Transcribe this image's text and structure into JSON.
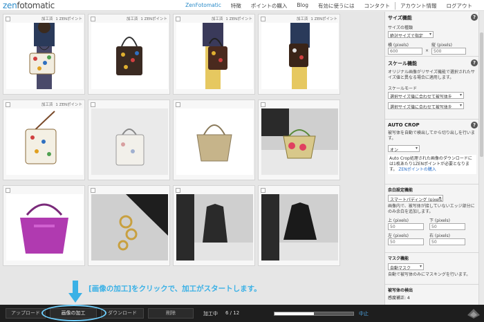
{
  "header": {
    "logo_zen": "zen",
    "logo_rest": "fotomatic",
    "nav": [
      {
        "label": "ZenFotomatic",
        "active": true
      },
      {
        "label": "特徴"
      },
      {
        "label": "ポイントの購入"
      },
      {
        "label": "Blog"
      },
      {
        "label": "有効に使うには"
      },
      {
        "label": "コンタクト"
      },
      {
        "label": "アカウント情報"
      },
      {
        "label": "ログアウト"
      }
    ]
  },
  "thumbnails": [
    {
      "status": "加工済",
      "points": "1 ZENポイント"
    },
    {
      "status": "加工済",
      "points": "1 ZENポイント"
    },
    {
      "status": "加工済",
      "points": "1 ZENポイント"
    },
    {
      "status": "加工済",
      "points": "1 ZENポイント"
    },
    {
      "status": "加工済",
      "points": "1 ZENポイント"
    },
    {
      "status": "",
      "points": ""
    },
    {
      "status": "",
      "points": ""
    },
    {
      "status": "",
      "points": ""
    },
    {
      "status": "",
      "points": ""
    },
    {
      "status": "",
      "points": ""
    },
    {
      "status": "",
      "points": ""
    },
    {
      "status": "",
      "points": ""
    }
  ],
  "sidebar": {
    "size": {
      "title": "サイズ機能",
      "type_label": "サイズの種類",
      "type_value": "絶対サイズで指定",
      "width_label": "横 (pixels)",
      "width_value": "600",
      "times": "×",
      "height_label": "縦 (pixels)",
      "height_value": "500"
    },
    "scale": {
      "title": "スケール機能",
      "desc": "オリジナル画像がリサイズ機能で選択されたサイズ値と異なる場合に適用します。",
      "mode_label": "スケールモード",
      "mode_value1": "選択サイズ値に合わせて被写体を",
      "mode_value2": "選択サイズ値に合わせて被写体を"
    },
    "autocrop": {
      "title": "AUTO CROP",
      "desc": "被写体を自動で検出してから切り出しを行います。",
      "value": "オン",
      "note": "Auto Crop処理された画像のダウンロードには1枚あたり1ZENポイントが必要となります。",
      "note_link": "ZENポイントの購入"
    },
    "margin": {
      "title": "余白設定機能",
      "value": "スマートパディング (pixels)",
      "desc": "画像内で、被写体が接していないエッジ部分にのみ余白を追加します。",
      "top_label": "上 (pixels)",
      "top_value": "50",
      "bottom_label": "下 (pixels)",
      "bottom_value": "50",
      "left_label": "左 (pixels)",
      "left_value": "50",
      "right_label": "右 (pixels)",
      "right_value": "50"
    },
    "mask": {
      "title": "マスク機能",
      "value": "自動マスク",
      "desc": "自動で被写体のみにマスキングを行います。"
    },
    "detect": {
      "title": "被写体の検出",
      "sensitivity": "感度補正: 4"
    }
  },
  "bottom": {
    "upload": "アップロード",
    "process": "画像の加工",
    "download": "ダウンロード",
    "delete": "削除",
    "status": "加工中",
    "count": "6 / 12",
    "progress": 0.5,
    "stop": "中止"
  },
  "annotation": {
    "instruction": "[画像の加工]をクリックで、加工がスタートします。"
  }
}
